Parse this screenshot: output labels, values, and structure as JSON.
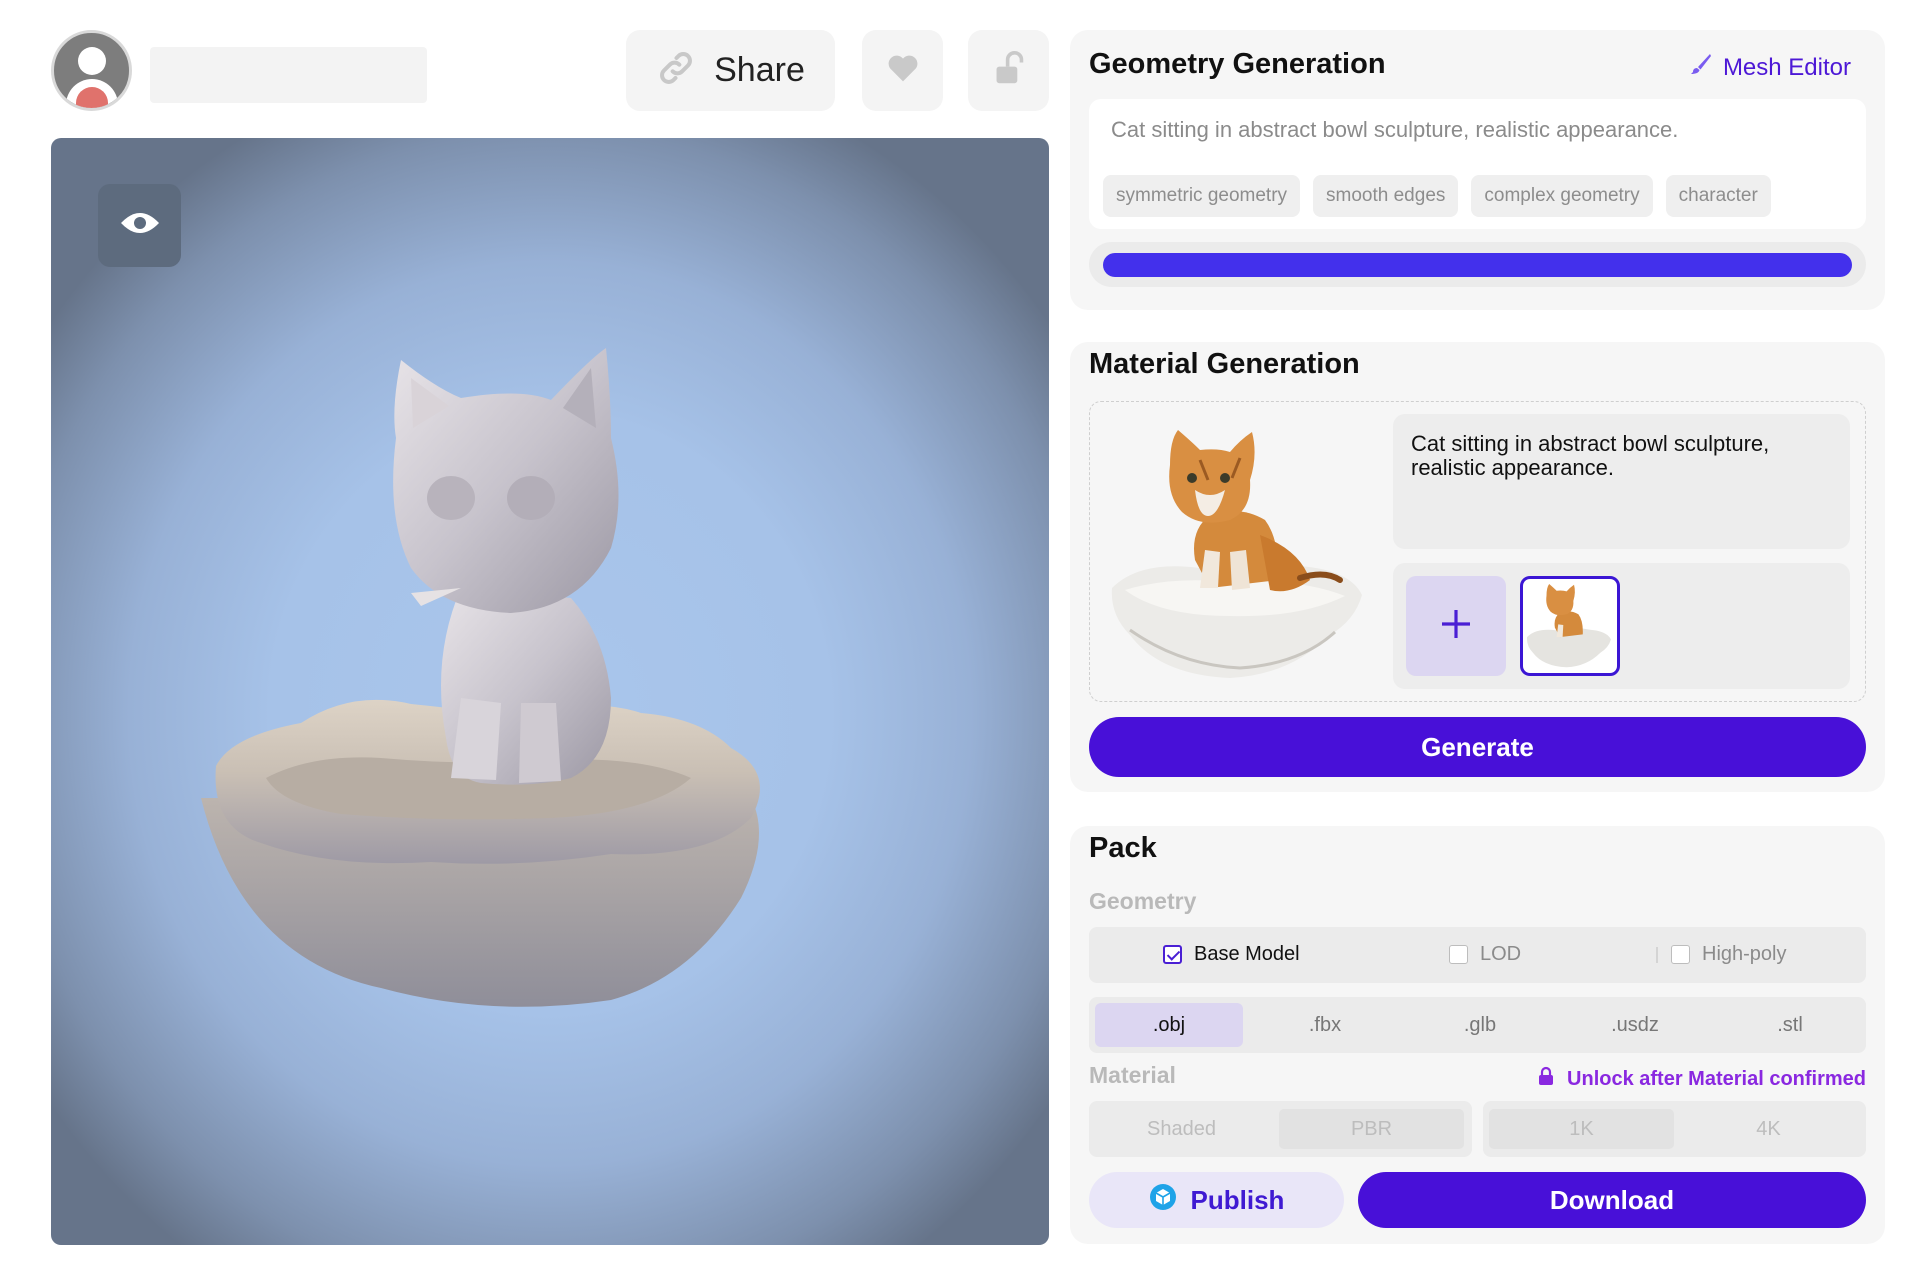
{
  "header": {
    "share_label": "Share",
    "icons": {
      "share": "link-icon",
      "like": "heart-icon",
      "lock": "unlock-icon",
      "avatar": "user-avatar-icon"
    }
  },
  "viewer": {
    "eye_icon": "eye-icon"
  },
  "geometry": {
    "title": "Geometry Generation",
    "mesh_editor_label": "Mesh Editor",
    "prompt": "Cat sitting in abstract bowl sculpture, realistic appearance.",
    "tags": [
      "symmetric geometry",
      "smooth edges",
      "complex geometry",
      "character"
    ],
    "progress": 1.0
  },
  "material": {
    "title": "Material Generation",
    "prompt": "Cat sitting in abstract bowl sculpture, realistic appearance.",
    "add_symbol": "+",
    "generate_label": "Generate"
  },
  "pack": {
    "title": "Pack",
    "geometry_label": "Geometry",
    "options": [
      {
        "label": "Base Model",
        "checked": true
      },
      {
        "label": "LOD",
        "checked": false
      },
      {
        "label": "High-poly",
        "checked": false
      }
    ],
    "formats": [
      ".obj",
      ".fbx",
      ".glb",
      ".usdz",
      ".stl"
    ],
    "selected_format": ".obj",
    "material_label": "Material",
    "unlock_label": "Unlock after Material confirmed",
    "material_types": [
      "Shaded",
      "PBR"
    ],
    "resolutions": [
      "1K",
      "4K"
    ],
    "publish_label": "Publish",
    "download_label": "Download"
  },
  "colors": {
    "accent": "#4810d8",
    "progress": "#4330ec",
    "unlock": "#8a28e0",
    "viewer_bg": "#a9c6ec"
  }
}
